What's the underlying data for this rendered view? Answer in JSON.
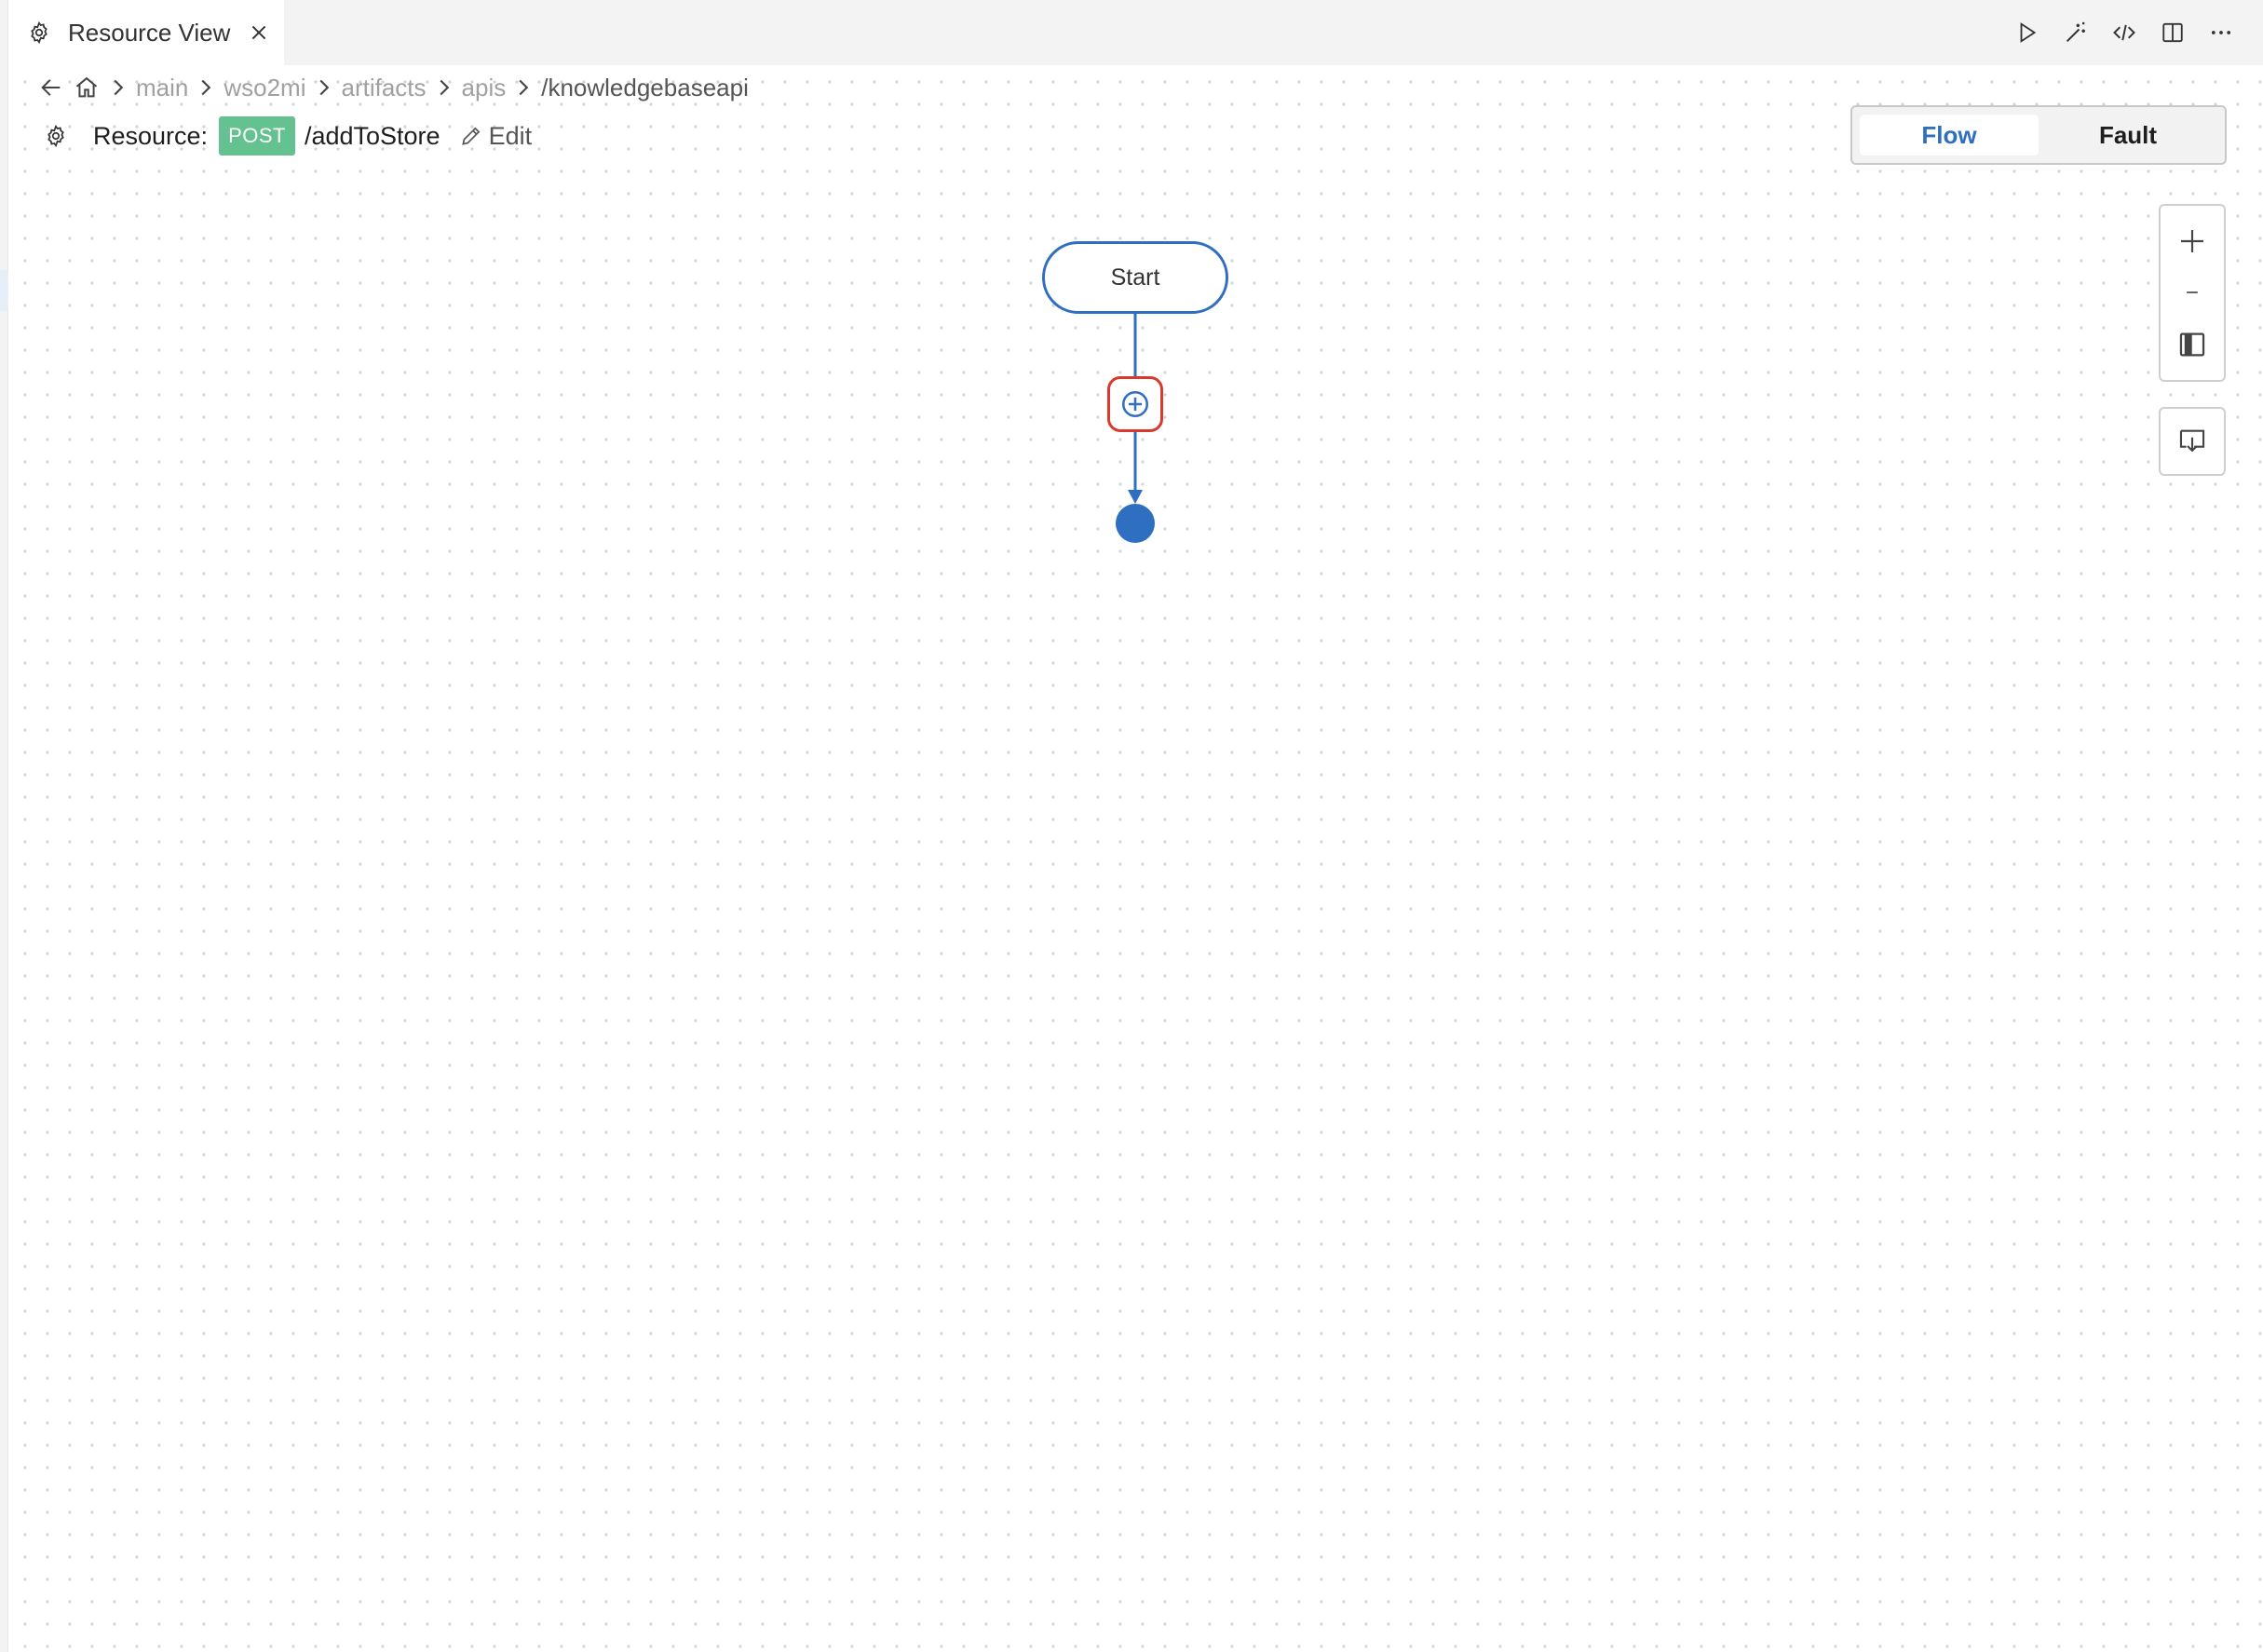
{
  "tab": {
    "title": "Resource View",
    "icon": "gear-icon"
  },
  "toolbar": [
    "run-icon",
    "magic-wand-icon",
    "code-icon",
    "split-editor-icon",
    "more-icon"
  ],
  "breadcrumb": {
    "items": [
      "main",
      "wso2mi",
      "artifacts",
      "apis",
      "/knowledgebaseapi"
    ]
  },
  "resource": {
    "label": "Resource:",
    "method": "POST",
    "path": "/addToStore",
    "edit_label": "Edit"
  },
  "view_toggle": {
    "flow": "Flow",
    "fault": "Fault",
    "selected": "Flow"
  },
  "diagram": {
    "start_label": "Start",
    "colors": {
      "accent": "#2f6fc1",
      "add_highlight": "#d93a2b",
      "method_badge": "#63c290"
    }
  }
}
